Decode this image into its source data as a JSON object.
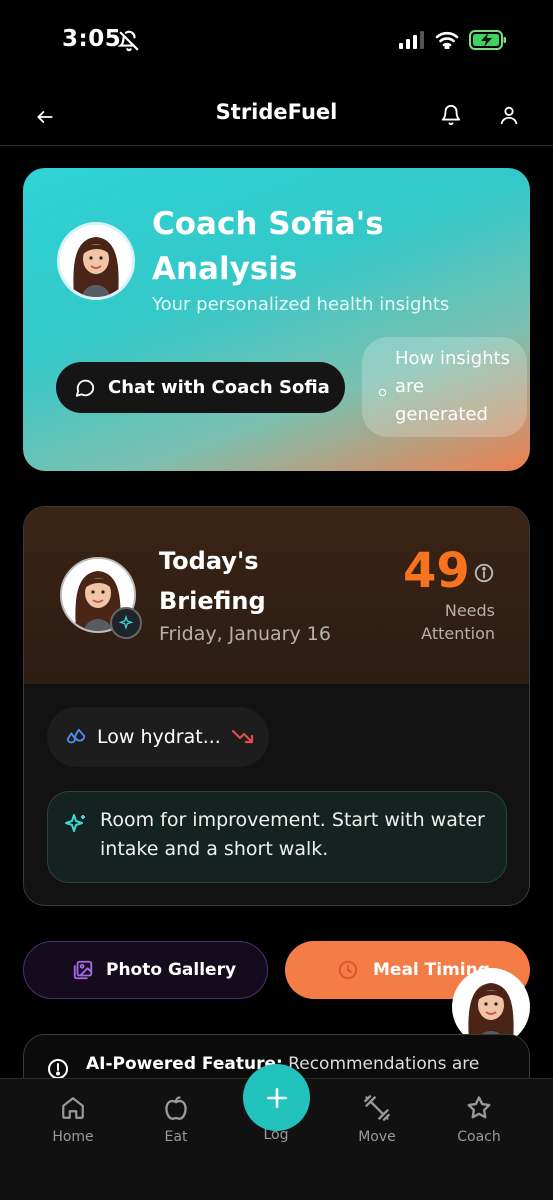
{
  "status_bar": {
    "time": "3:05"
  },
  "header": {
    "title": "StrideFuel"
  },
  "hero": {
    "title": "Coach Sofia's Analysis",
    "subtitle": "Your personalized health insights",
    "chat_button": "Chat with Coach Sofia",
    "how_button": "How insights are generated"
  },
  "briefing": {
    "title": "Today's Briefing",
    "date": "Friday, January 16",
    "score": "49",
    "score_label": "Needs Attention",
    "chip_label": "Low hydrat...",
    "insight": "Room for improvement. Start with water intake and a short walk."
  },
  "actions": {
    "gallery": "Photo Gallery",
    "meal": "Meal Timing"
  },
  "ai_notice": {
    "bold": "AI-Powered Feature:",
    "text": " Recommendations are"
  },
  "nav": {
    "home": "Home",
    "eat": "Eat",
    "log": "Log",
    "move": "Move",
    "coach": "Coach"
  },
  "colors": {
    "accent_teal": "#22c3bd",
    "accent_orange": "#f37c47",
    "score_orange": "#f7731f"
  }
}
